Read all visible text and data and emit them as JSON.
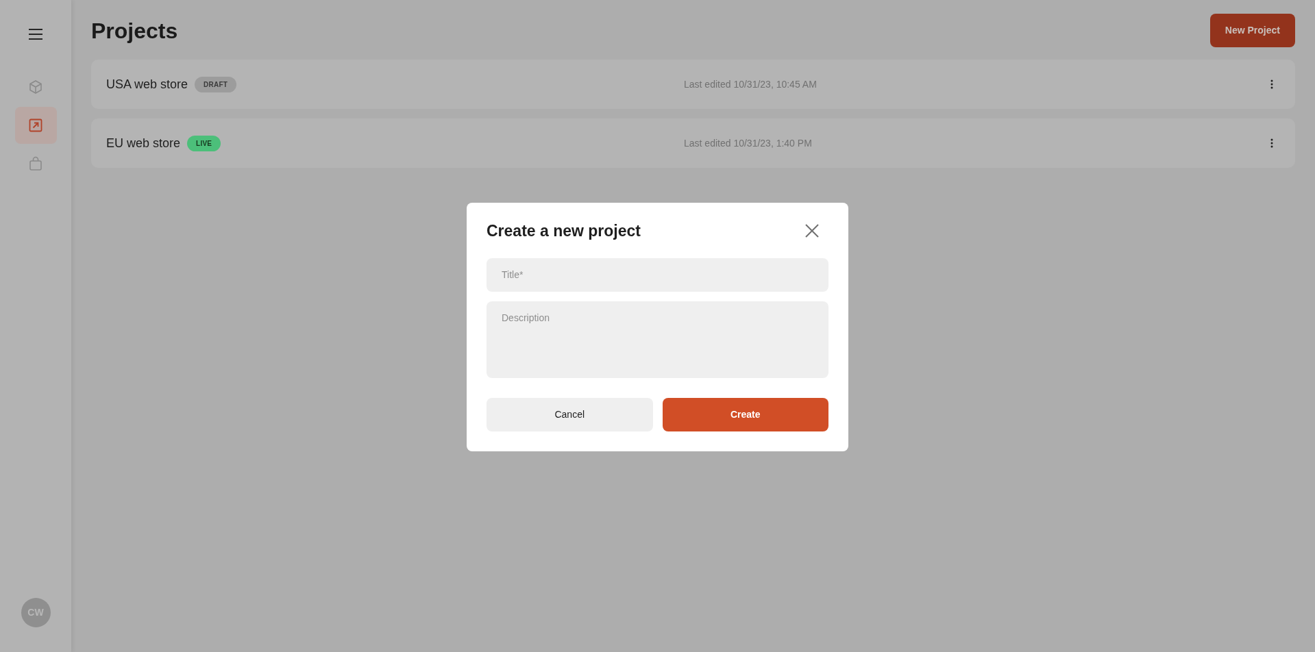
{
  "sidebar": {
    "avatar": "CW",
    "items": [
      {
        "kind": "cube",
        "selected": false
      },
      {
        "kind": "arrow",
        "selected": true
      },
      {
        "kind": "bag",
        "selected": false
      }
    ]
  },
  "page": {
    "title": "Projects",
    "new_button": "New Project"
  },
  "projects": [
    {
      "name": "USA web store",
      "status": "DRAFT",
      "kind": "draft",
      "edited": "Last edited 10/31/23, 10:45 AM"
    },
    {
      "name": "EU web store",
      "status": "LIVE",
      "kind": "live",
      "edited": "Last edited 10/31/23, 1:40 PM"
    }
  ],
  "dialog": {
    "title": "Create a new project",
    "title_placeholder": "Title*",
    "description_placeholder": "Description",
    "cancel": "Cancel",
    "create": "Create"
  }
}
